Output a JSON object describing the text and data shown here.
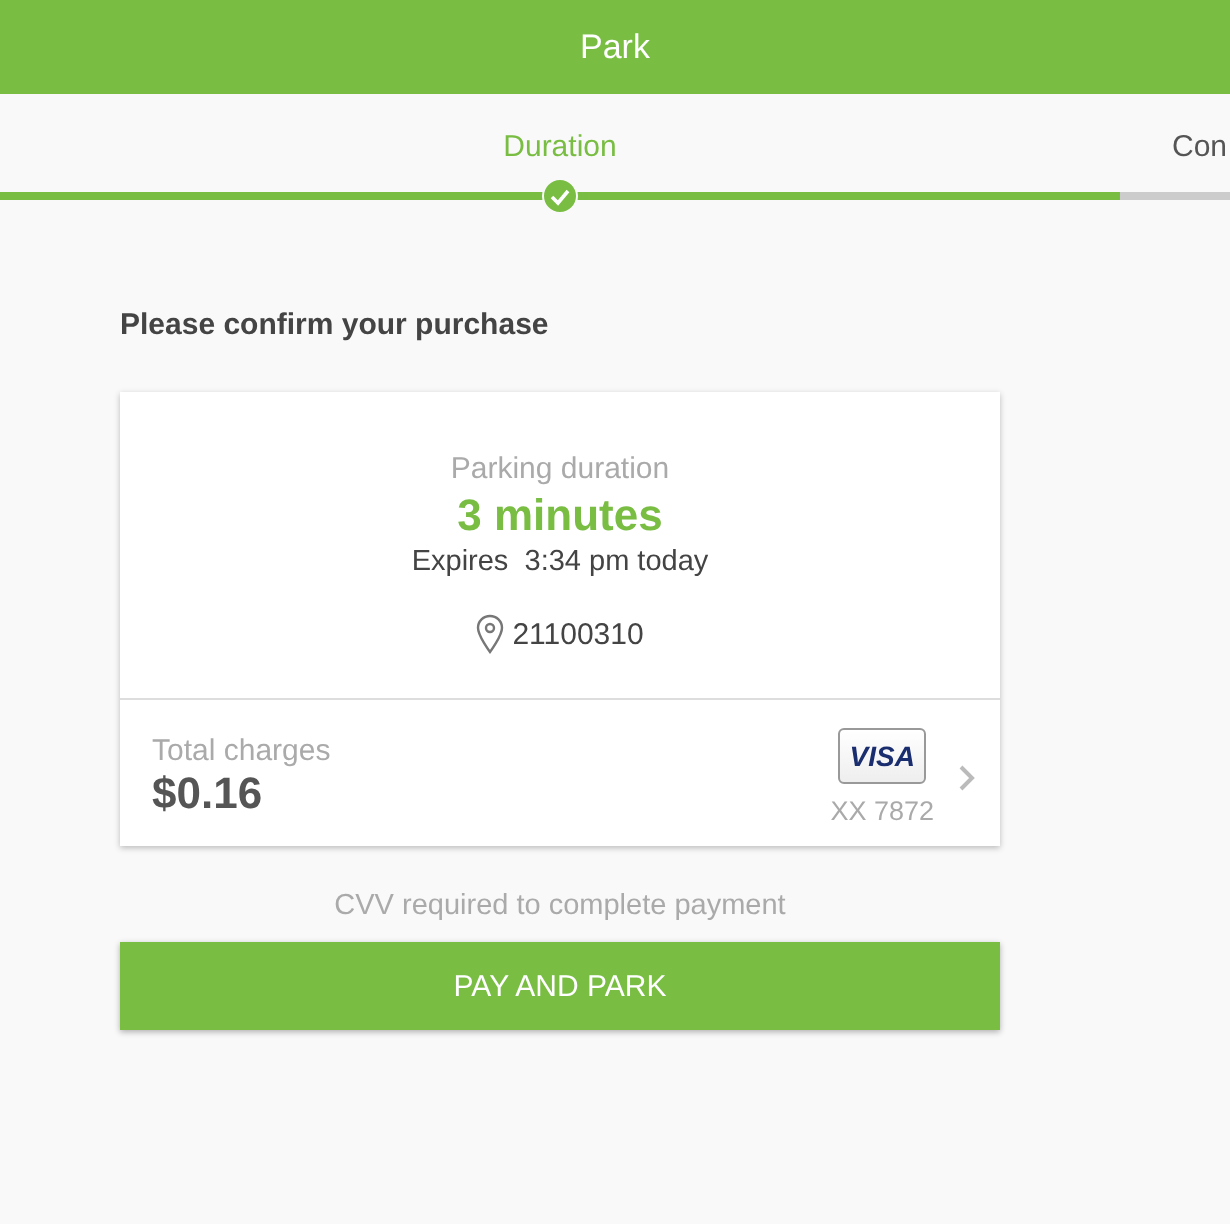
{
  "header": {
    "title": "Park"
  },
  "steps": [
    {
      "label": "Duration",
      "completed": true
    },
    {
      "label": "Con",
      "completed": false
    }
  ],
  "prompt": "Please confirm your purchase",
  "summary": {
    "duration_label": "Parking duration",
    "duration": "3 minutes",
    "expires_label": "Expires",
    "expires": "3:34 pm today",
    "zone": "21100310"
  },
  "payment": {
    "total_label": "Total charges",
    "total": "$0.16",
    "card_brand": "VISA",
    "card_number": "XX 7872"
  },
  "cvv_note": "CVV required to complete payment",
  "pay_button": "PAY AND PARK"
}
